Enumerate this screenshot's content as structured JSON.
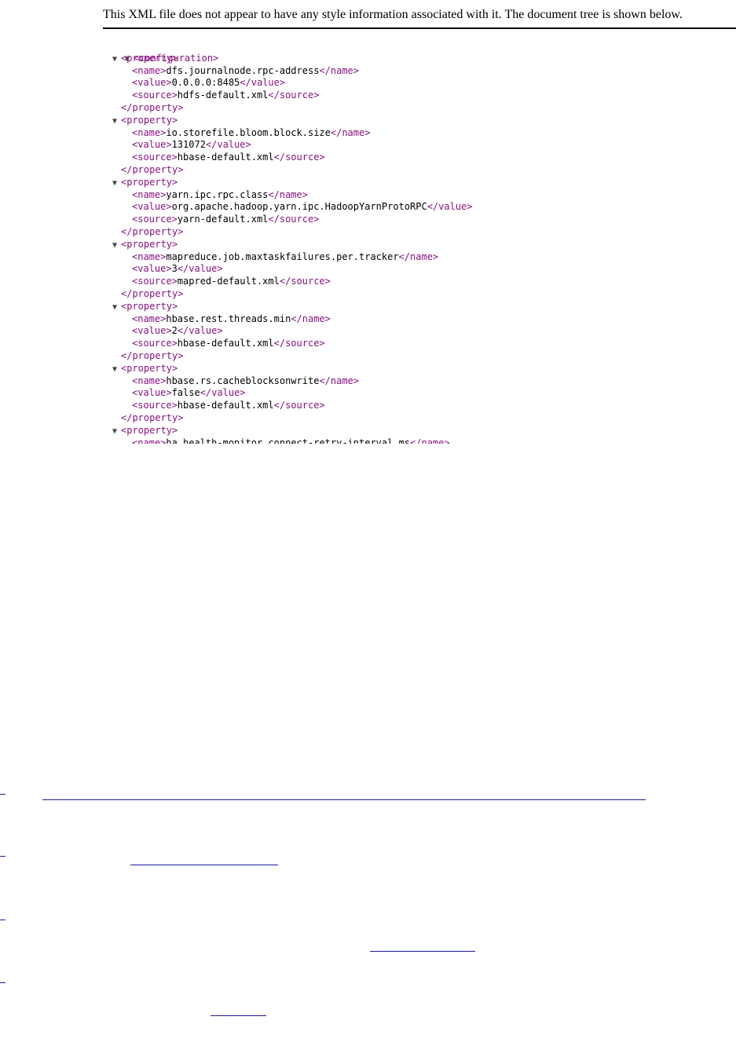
{
  "banner": {
    "message": "This XML file does not appear to have any style information associated with it. The document tree is shown below."
  },
  "icons": {
    "collapse": "triangle-down-icon"
  },
  "colors": {
    "tag": "#881280",
    "text": "#000000",
    "link": "#1a1aa6"
  },
  "xml": {
    "root_open": "<configuration>",
    "properties": [
      {
        "open": "<property>",
        "name_open": "<name>",
        "name": "dfs.journalnode.rpc-address",
        "name_close": "</name>",
        "value_open": "<value>",
        "value": "0.0.0.0:8485",
        "value_close": "</value>",
        "source_open": "<source>",
        "source": "hdfs-default.xml",
        "source_close": "</source>",
        "close": "</property>"
      },
      {
        "open": "<property>",
        "name_open": "<name>",
        "name": "io.storefile.bloom.block.size",
        "name_close": "</name>",
        "value_open": "<value>",
        "value": "131072",
        "value_close": "</value>",
        "source_open": "<source>",
        "source": "hbase-default.xml",
        "source_close": "</source>",
        "close": "</property>"
      },
      {
        "open": "<property>",
        "name_open": "<name>",
        "name": "yarn.ipc.rpc.class",
        "name_close": "</name>",
        "value_open": "<value>",
        "value": "org.apache.hadoop.yarn.ipc.HadoopYarnProtoRPC",
        "value_close": "</value>",
        "source_open": "<source>",
        "source": "yarn-default.xml",
        "source_close": "</source>",
        "close": "</property>"
      },
      {
        "open": "<property>",
        "name_open": "<name>",
        "name": "mapreduce.job.maxtaskfailures.per.tracker",
        "name_close": "</name>",
        "value_open": "<value>",
        "value": "3",
        "value_close": "</value>",
        "source_open": "<source>",
        "source": "mapred-default.xml",
        "source_close": "</source>",
        "close": "</property>"
      },
      {
        "open": "<property>",
        "name_open": "<name>",
        "name": "hbase.rest.threads.min",
        "name_close": "</name>",
        "value_open": "<value>",
        "value": "2",
        "value_close": "</value>",
        "source_open": "<source>",
        "source": "hbase-default.xml",
        "source_close": "</source>",
        "close": "</property>"
      },
      {
        "open": "<property>",
        "name_open": "<name>",
        "name": "hbase.rs.cacheblocksonwrite",
        "name_close": "</name>",
        "value_open": "<value>",
        "value": "false",
        "value_close": "</value>",
        "source_open": "<source>",
        "source": "hbase-default.xml",
        "source_close": "</source>",
        "close": "</property>"
      }
    ],
    "last_property": {
      "open": "<property>",
      "name_open": "<name>",
      "name": "ha.health-monitor.connect-retry-interval.ms",
      "name_close": "</name>"
    }
  }
}
